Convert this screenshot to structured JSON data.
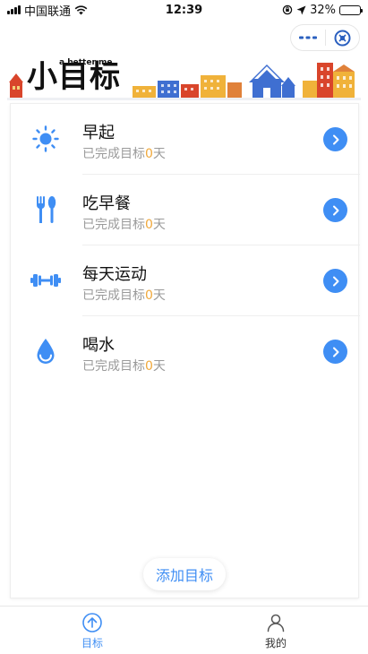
{
  "status_bar": {
    "carrier": "中国联通",
    "time": "12:39",
    "battery_percent": "32%",
    "battery_level": 0.32
  },
  "capsule": {
    "more_icon": "more-dots-icon",
    "close_icon": "close-circle-icon"
  },
  "banner": {
    "title": "小目标",
    "subtitle": "a better me"
  },
  "goals": [
    {
      "name": "早起",
      "icon": "sun-icon",
      "progress_prefix": "已完成目标",
      "progress_count": "0",
      "progress_suffix": "天"
    },
    {
      "name": "吃早餐",
      "icon": "fork-spoon-icon",
      "progress_prefix": "已完成目标",
      "progress_count": "0",
      "progress_suffix": "天"
    },
    {
      "name": "每天运动",
      "icon": "dumbbell-icon",
      "progress_prefix": "已完成目标",
      "progress_count": "0",
      "progress_suffix": "天"
    },
    {
      "name": "喝水",
      "icon": "water-drop-icon",
      "progress_prefix": "已完成目标",
      "progress_count": "0",
      "progress_suffix": "天"
    }
  ],
  "add_goal_label": "添加目标",
  "tabbar": {
    "goal_label": "目标",
    "mine_label": "我的"
  },
  "colors": {
    "accent": "#3f8ef4",
    "count": "#f0a83b",
    "muted_text": "#9a9a9a"
  }
}
